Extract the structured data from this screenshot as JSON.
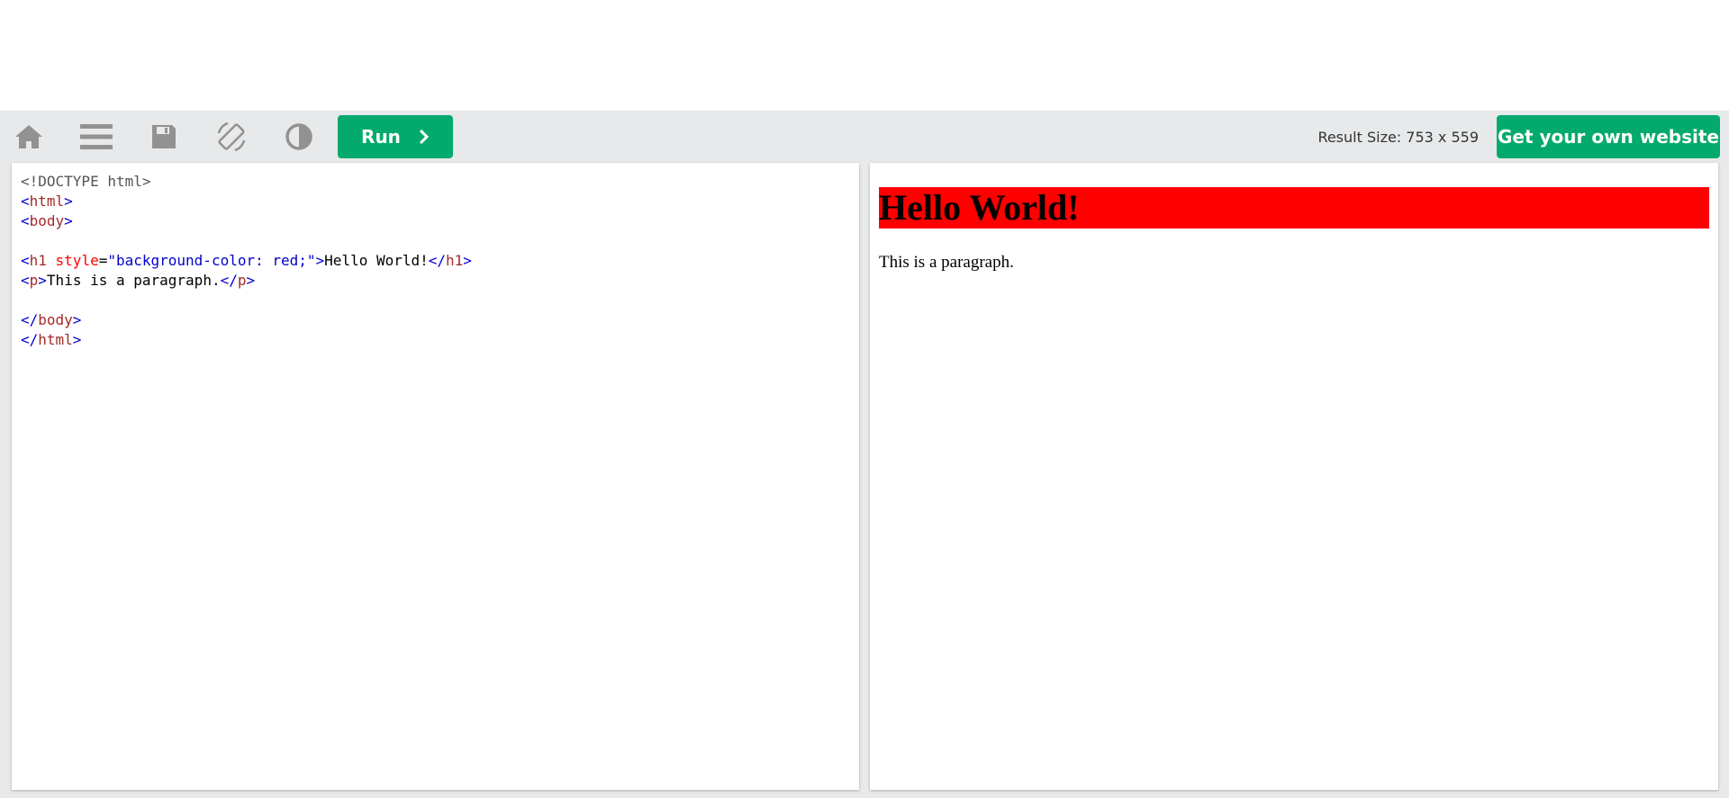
{
  "toolbar": {
    "icons": [
      "home-icon",
      "menu-icon",
      "save-icon",
      "rotate-screen-icon",
      "contrast-icon"
    ],
    "run_label": "Run",
    "result_size": "Result Size: 753 x 559",
    "own_website_label": "Get your own website",
    "accent_color": "#04aa6d",
    "icon_color": "#929292"
  },
  "editor": {
    "lines": {
      "l1": "<!DOCTYPE html>",
      "l2": {
        "open": "<",
        "tag": "html",
        "close": ">"
      },
      "l3": {
        "open": "<",
        "tag": "body",
        "close": ">"
      },
      "l5": {
        "open": "<",
        "tag": "h1",
        "attr": " style",
        "eq": "=",
        "value": "\"background-color: red;\"",
        "close": ">",
        "text": "Hello World!",
        "end_open": "</",
        "end_tag": "h1",
        "end_close": ">"
      },
      "l6": {
        "open": "<",
        "tag": "p",
        "close": ">",
        "text": "This is a paragraph.",
        "end_open": "</",
        "end_tag": "p",
        "end_close": ">"
      },
      "l8": {
        "open": "</",
        "tag": "body",
        "close": ">"
      },
      "l9": {
        "open": "</",
        "tag": "html",
        "close": ">"
      }
    }
  },
  "result": {
    "heading": "Hello World!",
    "heading_bg": "#ff0000",
    "paragraph": "This is a paragraph."
  }
}
